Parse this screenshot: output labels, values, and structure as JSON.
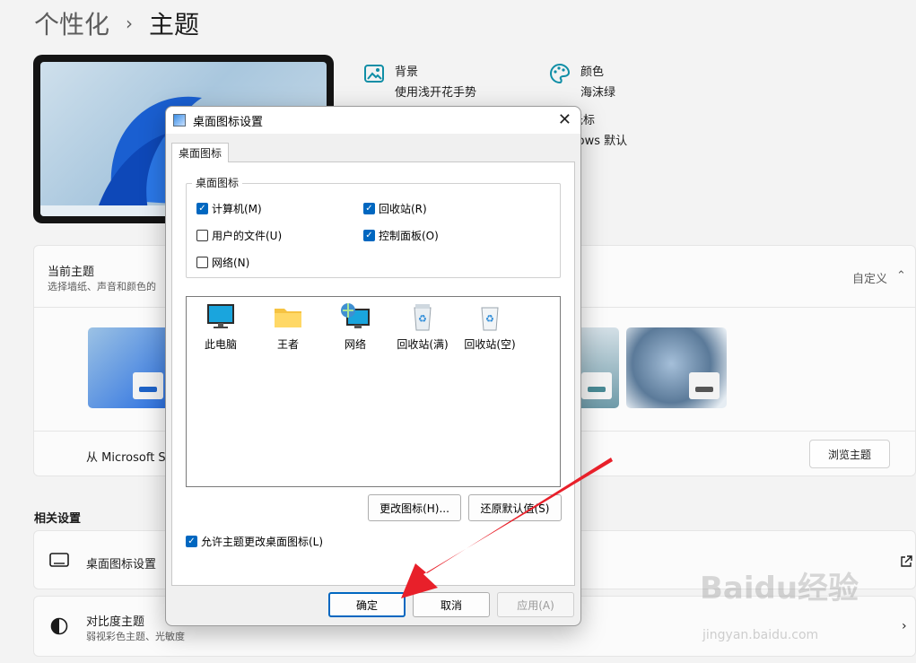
{
  "breadcrumb": {
    "parent": "个性化",
    "separator": "›",
    "current": "主题"
  },
  "theme_info": [
    {
      "title": "背景",
      "value": "使用浅开花手势",
      "icon": "image-icon"
    },
    {
      "title": "颜色",
      "value": "海沫绿",
      "icon": "palette-icon"
    },
    {
      "title": "鼠标光标",
      "value": "Windows 默认",
      "icon": "cursor-icon"
    }
  ],
  "current_theme": {
    "title": "当前主题",
    "subtitle": "选择墙纸、声音和颜色的",
    "value": "自定义"
  },
  "store": {
    "text": "从 Microsoft S",
    "button": "浏览主题"
  },
  "related": {
    "header": "相关设置",
    "items": [
      {
        "title": "桌面图标设置",
        "icon": "desktop-icon"
      },
      {
        "title": "对比度主题",
        "subtitle": "弱视彩色主题、光敏度",
        "icon": "contrast-icon"
      }
    ]
  },
  "dialog": {
    "title": "桌面图标设置",
    "tab": "桌面图标",
    "group_title": "桌面图标",
    "checkboxes": [
      {
        "label": "计算机(M)",
        "checked": true
      },
      {
        "label": "回收站(R)",
        "checked": true
      },
      {
        "label": "用户的文件(U)",
        "checked": false
      },
      {
        "label": "控制面板(O)",
        "checked": true
      },
      {
        "label": "网络(N)",
        "checked": false
      }
    ],
    "icons": [
      {
        "label": "此电脑",
        "icon": "monitor-icon"
      },
      {
        "label": "王者",
        "icon": "folder-icon"
      },
      {
        "label": "网络",
        "icon": "network-icon"
      },
      {
        "label": "回收站(满)",
        "icon": "recycle-bin-full-icon"
      },
      {
        "label": "回收站(空)",
        "icon": "recycle-bin-empty-icon"
      }
    ],
    "change_icon": "更改图标(H)...",
    "restore_default": "还原默认值(S)",
    "allow_themes": "允许主题更改桌面图标(L)",
    "allow_themes_checked": true,
    "ok": "确定",
    "cancel": "取消",
    "apply": "应用(A)"
  },
  "watermark": {
    "brand": "Baidu经验",
    "url": "jingyan.baidu.com"
  },
  "colors": {
    "accent": "#0067c0",
    "arrow": "#e8202a",
    "teal": "#0f8ea6"
  }
}
